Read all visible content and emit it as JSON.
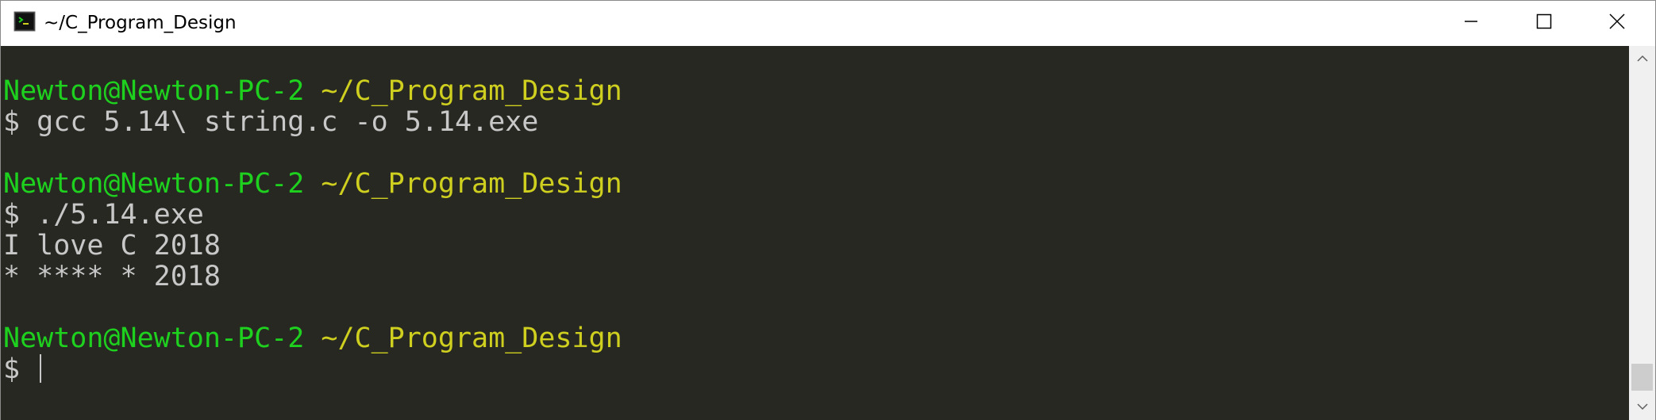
{
  "window": {
    "title": "~/C_Program_Design",
    "icons": {
      "app": "terminal-icon",
      "minimize": "minimize-icon",
      "maximize": "maximize-icon",
      "close": "close-icon"
    }
  },
  "colors": {
    "background": "#272822",
    "prompt_user": "#1fd11f",
    "prompt_path": "#cfcf1f",
    "text": "#c8c8c8"
  },
  "terminal": {
    "lines": [
      {
        "user": "",
        "path": "",
        "text": ""
      },
      {
        "user": "Newton@Newton-PC-2",
        "path": "~/C_Program_Design",
        "text": ""
      },
      {
        "user": "",
        "path": "",
        "text": "$ gcc 5.14\\ string.c -o 5.14.exe"
      },
      {
        "user": "",
        "path": "",
        "text": ""
      },
      {
        "user": "Newton@Newton-PC-2",
        "path": "~/C_Program_Design",
        "text": ""
      },
      {
        "user": "",
        "path": "",
        "text": "$ ./5.14.exe"
      },
      {
        "user": "",
        "path": "",
        "text": "I love C 2018"
      },
      {
        "user": "",
        "path": "",
        "text": "* **** * 2018"
      },
      {
        "user": "",
        "path": "",
        "text": ""
      },
      {
        "user": "Newton@Newton-PC-2",
        "path": "~/C_Program_Design",
        "text": ""
      },
      {
        "user": "",
        "path": "",
        "text": "$ "
      }
    ],
    "cursor_line": 10
  },
  "scrollbar": {
    "up_icon": "scroll-up-arrow-icon",
    "down_icon": "scroll-down-arrow-icon"
  }
}
